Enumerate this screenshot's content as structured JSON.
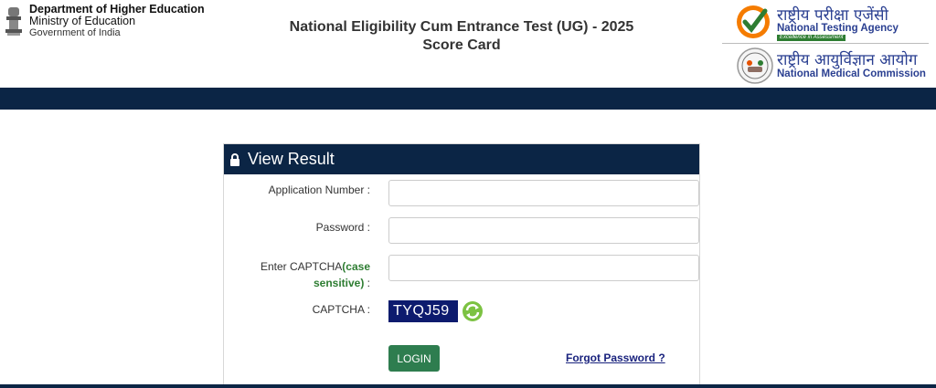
{
  "header": {
    "dept_line1": "Department of Higher Education",
    "dept_line2": "Ministry of Education",
    "dept_line3": "Government of India",
    "title_line1": "National Eligibility Cum Entrance Test (UG) - 2025",
    "title_line2": "Score Card",
    "nta_hindi": "राष्ट्रीय परीक्षा एजेंसी",
    "nta_english": "National Testing Agency",
    "nta_tagline": "Excellence in Assessment",
    "nmc_hindi": "राष्ट्रीय आयुर्विज्ञान आयोग",
    "nmc_english": "National Medical Commission"
  },
  "panel": {
    "title": "View Result",
    "application_label": "Application Number :",
    "application_value": "",
    "password_label": "Password :",
    "password_value": "",
    "captcha_input_label_prefix": "Enter CAPTCHA",
    "captcha_input_label_green1": "(case",
    "captcha_input_label_green2": "sensitive)",
    "captcha_input_label_suffix": " :",
    "captcha_input_value": "",
    "captcha_label": "CAPTCHA :",
    "captcha_text": "TYQJ59",
    "login_label": "LOGIN",
    "forgot_label": "Forgot Password ?"
  },
  "colors": {
    "navy": "#0b2545",
    "login_green": "#2e7d4f",
    "captcha_bg": "#0d1b6e",
    "link": "#1a237e"
  }
}
